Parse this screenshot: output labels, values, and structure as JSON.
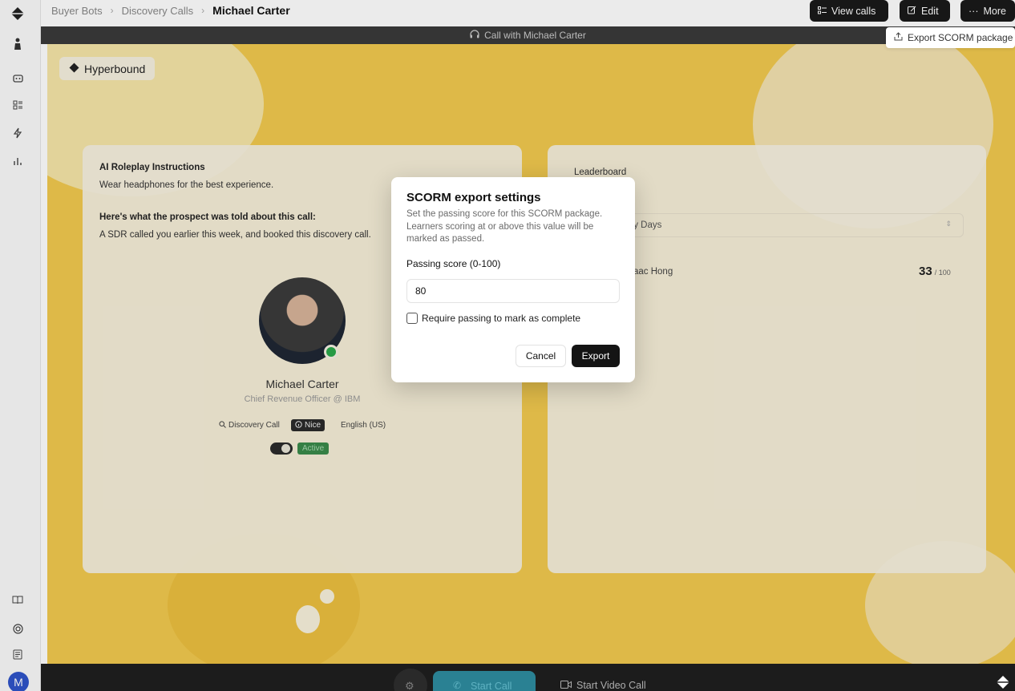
{
  "breadcrumb": {
    "items": [
      "Buyer Bots",
      "Discovery Calls"
    ],
    "current": "Michael Carter"
  },
  "toolbar": {
    "view_calls": "View calls",
    "edit": "Edit",
    "more": "More"
  },
  "more_menu": {
    "export_scorm": "Export SCORM package"
  },
  "call_banner": "Call with Michael Carter",
  "brand": "Hyperbound",
  "instructions": {
    "title": "AI Roleplay Instructions",
    "hint": "Wear headphones for the best experience.",
    "told_title": "Here's what the prospect was told about this call:",
    "told_text": "A SDR called you earlier this week, and booked this discovery call."
  },
  "persona": {
    "name": "Michael Carter",
    "role": "Chief Revenue Officer @ IBM",
    "tags": [
      "Discovery Call",
      "Nice",
      "English (US)"
    ],
    "status": "Active"
  },
  "leaderboard": {
    "title": "Leaderboard",
    "period": "ty Days",
    "entry_name": "aac Hong",
    "entry_score": "33",
    "entry_max": "/ 100"
  },
  "bottom": {
    "start_call": "Start Call",
    "start_video": "Start Video Call"
  },
  "dialog": {
    "title": "SCORM export settings",
    "description": "Set the passing score for this SCORM package. Learners scoring at or above this value will be marked as passed.",
    "passing_label": "Passing score (0-100)",
    "passing_value": "80",
    "require_label": "Require passing to mark as complete",
    "cancel": "Cancel",
    "export": "Export"
  },
  "avatar_initial": "M"
}
